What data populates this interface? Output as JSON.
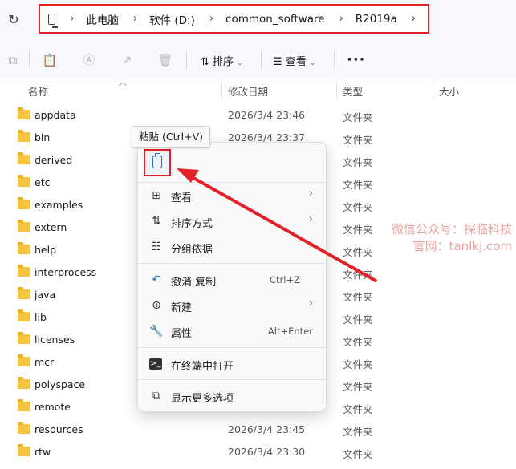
{
  "address": {
    "refresh_icon": "refresh-icon",
    "pc_icon": "this-pc-icon",
    "crumbs": [
      "此电脑",
      "软件 (D:)",
      "common_software",
      "R2019a"
    ],
    "border_color": "#e0212a"
  },
  "toolbar": {
    "sort_label": "排序",
    "view_label": "查看",
    "more_label": "···"
  },
  "columns": {
    "name": "名称",
    "modified": "修改日期",
    "type": "类型",
    "size": "大小"
  },
  "files": [
    {
      "name": "appdata",
      "date": "2026/3/4 23:46",
      "type": "文件夹"
    },
    {
      "name": "bin",
      "date": "2026/3/4 23:37",
      "type": "文件夹"
    },
    {
      "name": "derived",
      "date": "",
      "type": "文件夹"
    },
    {
      "name": "etc",
      "date": "",
      "type": "文件夹"
    },
    {
      "name": "examples",
      "date": "",
      "type": "文件夹"
    },
    {
      "name": "extern",
      "date": "",
      "type": "文件夹"
    },
    {
      "name": "help",
      "date": "",
      "type": "文件夹"
    },
    {
      "name": "interprocess",
      "date": "",
      "type": "文件夹"
    },
    {
      "name": "java",
      "date": "",
      "type": "文件夹"
    },
    {
      "name": "lib",
      "date": "",
      "type": "文件夹"
    },
    {
      "name": "licenses",
      "date": "",
      "type": "文件夹"
    },
    {
      "name": "mcr",
      "date": "",
      "type": "文件夹"
    },
    {
      "name": "polyspace",
      "date": "",
      "type": "文件夹"
    },
    {
      "name": "remote",
      "date": "",
      "type": "文件夹"
    },
    {
      "name": "resources",
      "date": "2026/3/4 23:45",
      "type": "文件夹"
    },
    {
      "name": "rtw",
      "date": "2026/3/4 23:30",
      "type": "文件夹"
    }
  ],
  "tooltip": "粘贴 (Ctrl+V)",
  "context_menu": {
    "view": "查看",
    "sort": "排序方式",
    "group": "分组依据",
    "undo": "撤消 复制",
    "undo_shortcut": "Ctrl+Z",
    "new": "新建",
    "properties": "属性",
    "properties_shortcut": "Alt+Enter",
    "terminal": "在终端中打开",
    "more": "显示更多选项"
  },
  "watermark": {
    "line1": "微信公众号：探临科技",
    "line2": "官网：tanlkj.com"
  },
  "colors": {
    "highlight_red": "#e0212a",
    "accent_blue": "#2e6fb5",
    "folder_yellow": "#f6c342"
  }
}
